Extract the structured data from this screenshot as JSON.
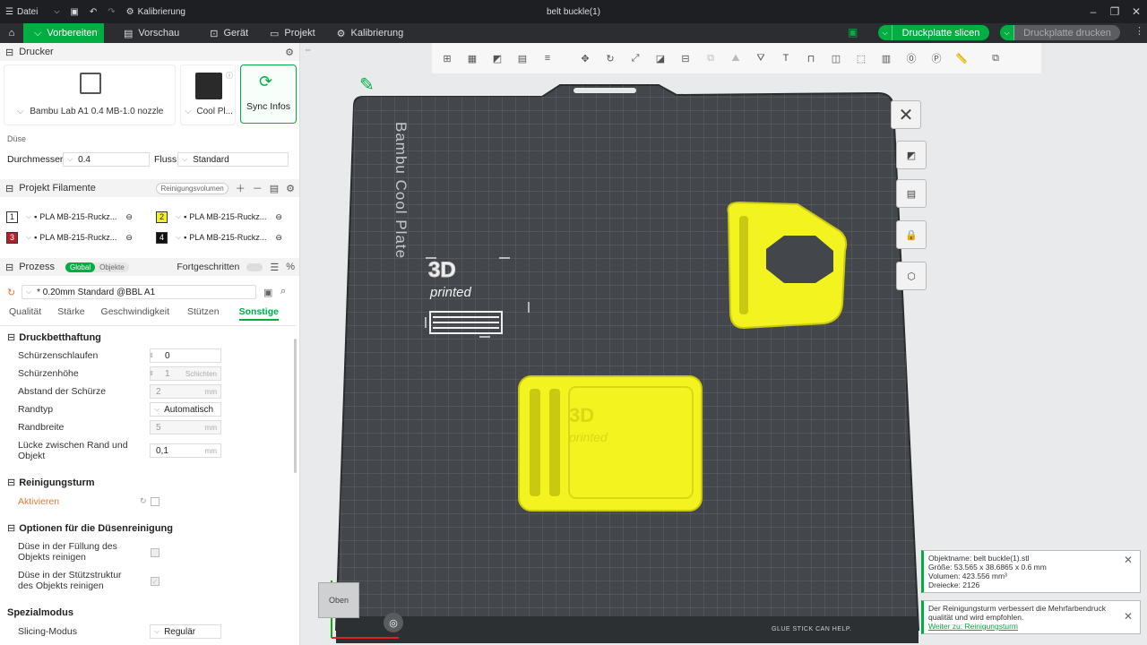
{
  "titlebar": {
    "menu_label": "Datei",
    "calibration_label": "Kalibrierung",
    "window_title": "belt buckle(1)"
  },
  "nav": {
    "tabs": [
      "Vorbereiten",
      "Vorschau",
      "Gerät",
      "Projekt",
      "Kalibrierung"
    ],
    "slice_button": "Druckplatte slicen",
    "print_button": "Druckplatte drucken"
  },
  "printer": {
    "header": "Drucker",
    "printer_name": "Bambu Lab A1 0.4 MB-1.0 nozzle",
    "plate_name": "Cool Pl...",
    "sync_label": "Sync Infos",
    "nozzle_label": "Düse",
    "diameter_label": "Durchmesser",
    "diameter_value": "0.4",
    "flow_label": "Fluss",
    "flow_value": "Standard"
  },
  "filaments": {
    "header": "Projekt Filamente",
    "purge_button": "Reinigungsvolumen",
    "items": [
      {
        "num": "1",
        "name": "PLA MB-215-Ruckz...",
        "color": "#ffffff",
        "text_color": "#222222"
      },
      {
        "num": "2",
        "name": "PLA MB-215-Ruckz...",
        "color": "#f2f21a",
        "text_color": "#222222"
      },
      {
        "num": "3",
        "name": "PLA MB-215-Ruckz...",
        "color": "#b3202a",
        "text_color": "#ffffff"
      },
      {
        "num": "4",
        "name": "PLA MB-215-Ruckz...",
        "color": "#111111",
        "text_color": "#ffffff"
      }
    ]
  },
  "process": {
    "header": "Prozess",
    "toggle_global": "Global",
    "toggle_objects": "Objekte",
    "advanced_label": "Fortgeschritten",
    "profile": "* 0.20mm Standard @BBL A1",
    "tabs": [
      "Qualität",
      "Stärke",
      "Geschwindigkeit",
      "Stützen",
      "Sonstige"
    ],
    "active_tab": 4
  },
  "settings": {
    "bed_adhesion": "Druckbetthaftung",
    "skirt_loops_label": "Schürzenschlaufen",
    "skirt_loops_value": "0",
    "skirt_height_label": "Schürzenhöhe",
    "skirt_height_value": "1",
    "skirt_height_unit": "Schichten",
    "skirt_distance_label": "Abstand der Schürze",
    "skirt_distance_value": "2",
    "unit_mm": "mm",
    "brim_type_label": "Randtyp",
    "brim_type_value": "Automatisch",
    "brim_width_label": "Randbreite",
    "brim_width_value": "5",
    "brim_gap_label_1": "Lücke zwischen Rand und",
    "brim_gap_label_2": "Objekt",
    "brim_gap_value": "0,1",
    "prime_tower": "Reinigungsturm",
    "enable_label": "Aktivieren",
    "flush_options": "Optionen für die Düsenreinigung",
    "flush_infill_1": "Düse in der Füllung des",
    "flush_infill_2": "Objekts reinigen",
    "flush_support_1": "Düse in der Stützstruktur",
    "flush_support_2": "des Objekts reinigen",
    "special_mode": "Spezialmodus",
    "slicing_mode_label": "Slicing-Modus",
    "slicing_mode_value": "Regulär"
  },
  "canvas": {
    "plate_label": "Bambu Cool Plate",
    "view_label": "Oben",
    "plate_footer": "GLUE STICK CAN HELP.",
    "logo_big": "3D",
    "logo_small": "printed"
  },
  "popups": {
    "object_name": "Objektname: belt buckle(1).stl",
    "size": "Größe: 53.565 x 38.6865 x 0.6 mm",
    "volume": "Volumen: 423.556 mm³",
    "triangles": "Dreiecke: 2126",
    "tower_msg_1": "Der Reinigungsturm verbessert die Mehrfarbendruck",
    "tower_msg_2": "qualität und wird empfohlen.",
    "tower_link": "Weiter zu: Reinigungsturm"
  }
}
